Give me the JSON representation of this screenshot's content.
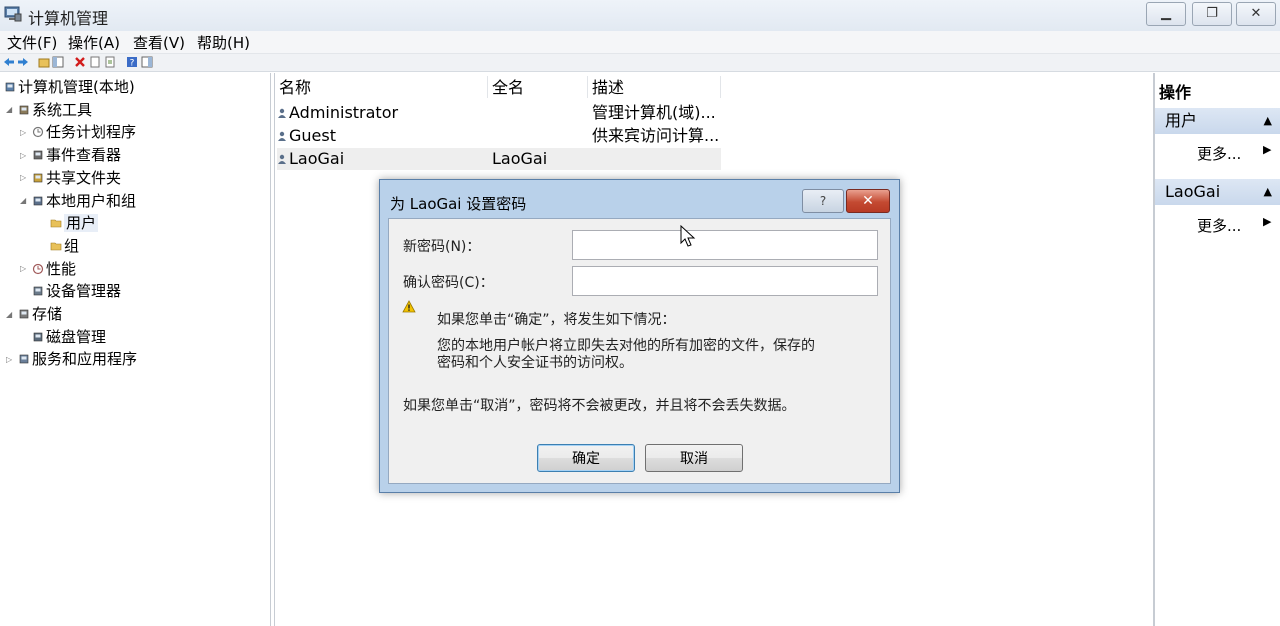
{
  "window": {
    "title": "计算机管理",
    "minimize_glyph": "▁",
    "restore_glyph": "❐",
    "close_glyph": "✕"
  },
  "menu": [
    "文件(F)",
    "操作(A)",
    "查看(V)",
    "帮助(H)"
  ],
  "tree": [
    {
      "label": "计算机管理(本地)",
      "level": 0,
      "expander": "",
      "icon": "computer-icon"
    },
    {
      "label": "系统工具",
      "level": 1,
      "expander": "◢",
      "icon": "tools-icon"
    },
    {
      "label": "任务计划程序",
      "level": 2,
      "expander": "▷",
      "icon": "clock-icon"
    },
    {
      "label": "事件查看器",
      "level": 2,
      "expander": "▷",
      "icon": "event-viewer-icon"
    },
    {
      "label": "共享文件夹",
      "level": 2,
      "expander": "▷",
      "icon": "shared-folder-icon"
    },
    {
      "label": "本地用户和组",
      "level": 2,
      "expander": "◢",
      "icon": "users-groups-icon"
    },
    {
      "label": "用户",
      "level": 3,
      "expander": "",
      "icon": "folder-icon",
      "selected": true
    },
    {
      "label": "组",
      "level": 3,
      "expander": "",
      "icon": "folder-icon"
    },
    {
      "label": "性能",
      "level": 2,
      "expander": "▷",
      "icon": "performance-icon"
    },
    {
      "label": "设备管理器",
      "level": 2,
      "expander": "",
      "icon": "device-manager-icon"
    },
    {
      "label": "存储",
      "level": 1,
      "expander": "◢",
      "icon": "storage-icon"
    },
    {
      "label": "磁盘管理",
      "level": 2,
      "expander": "",
      "icon": "disk-icon"
    },
    {
      "label": "服务和应用程序",
      "level": 1,
      "expander": "▷",
      "icon": "services-icon"
    }
  ],
  "list": {
    "columns": [
      "名称",
      "全名",
      "描述"
    ],
    "rows": [
      {
        "name": "Administrator",
        "fullname": "",
        "description": "管理计算机(域)..."
      },
      {
        "name": "Guest",
        "fullname": "",
        "description": "供来宾访问计算..."
      },
      {
        "name": "LaoGai",
        "fullname": "LaoGai",
        "description": "",
        "selected": true
      }
    ]
  },
  "actions": {
    "title": "操作",
    "sections": [
      {
        "name": "用户",
        "more": "更多..."
      },
      {
        "name": "LaoGai",
        "more": "更多..."
      }
    ]
  },
  "dialog": {
    "title": "为 LaoGai 设置密码",
    "help_glyph": "?",
    "close_glyph": "✕",
    "new_password_label": "新密码(N)：",
    "new_password_value": "",
    "confirm_password_label": "确认密码(C)：",
    "confirm_password_value": "",
    "warning_heading": "如果您单击“确定”，将发生如下情况：",
    "warning_line1": "您的本地用户帐户将立即失去对他的所有加密的文件，保存的",
    "warning_line2": "密码和个人安全证书的访问权。",
    "cancel_note": "如果您单击“取消”，密码将不会被更改，并且将不会丢失数据。",
    "ok_label": "确定",
    "cancel_label": "取消"
  },
  "colors": {
    "dialog_frame": "#b9d1ea",
    "dialog_close": "#c44a32",
    "action_header": "#c9d8ec",
    "warning": "#f2c200"
  }
}
